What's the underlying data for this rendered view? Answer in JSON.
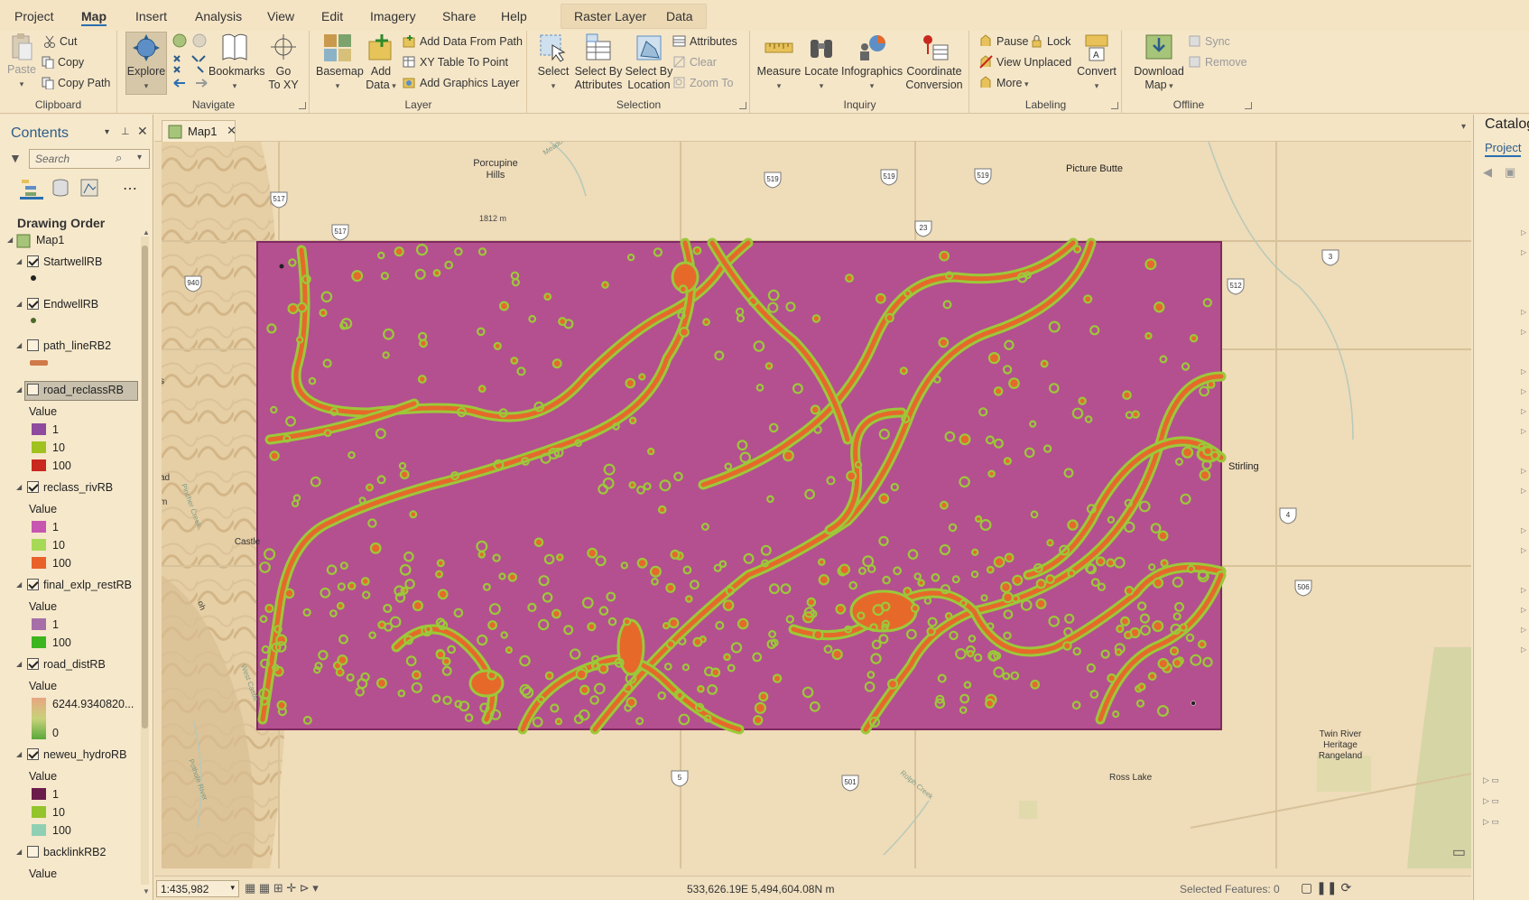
{
  "menubar": {
    "tabs": [
      "Project",
      "Map",
      "Insert",
      "Analysis",
      "View",
      "Edit",
      "Imagery",
      "Share",
      "Help"
    ],
    "active_tab": "Map",
    "context_tabs": [
      "Raster Layer",
      "Data"
    ]
  },
  "ribbon": {
    "clipboard": {
      "label": "Clipboard",
      "paste": "Paste",
      "cut": "Cut",
      "copy": "Copy",
      "copy_path": "Copy Path"
    },
    "navigate": {
      "label": "Navigate",
      "explore": "Explore",
      "bookmarks": "Bookmarks",
      "go_to": "Go",
      "go_to_2": "To XY"
    },
    "layer": {
      "label": "Layer",
      "basemap": "Basemap",
      "add": "Add",
      "add_data": "Data",
      "add_from_path": "Add Data From Path",
      "xy_table": "XY Table To Point",
      "add_graphics": "Add Graphics Layer"
    },
    "selection": {
      "label": "Selection",
      "select": "Select",
      "select_by": "Select By",
      "attributes": "Attributes",
      "location": "Location",
      "attributes_btn": "Attributes",
      "clear": "Clear",
      "zoom_to": "Zoom To"
    },
    "inquiry": {
      "label": "Inquiry",
      "measure": "Measure",
      "locate": "Locate",
      "infographics": "Infographics",
      "coordinate": "Coordinate",
      "conversion": "Conversion"
    },
    "labeling": {
      "label": "Labeling",
      "pause": "Pause",
      "lock": "Lock",
      "view_unplaced": "View Unplaced",
      "more": "More",
      "convert": "Convert"
    },
    "offline": {
      "label": "Offline",
      "download": "Download",
      "map": "Map",
      "sync": "Sync",
      "remove": "Remove"
    }
  },
  "contents": {
    "title": "Contents",
    "search_placeholder": "Search",
    "section": "Drawing Order",
    "map_name": "Map1",
    "value_label": "Value",
    "layers": [
      {
        "name": "StartwellRB",
        "checked": true
      },
      {
        "name": "EndwellRB",
        "checked": true
      },
      {
        "name": "path_lineRB2",
        "checked": false
      },
      {
        "name": "road_reclassRB",
        "checked": false,
        "selected": true,
        "legend": [
          {
            "v": "1",
            "c": "#8e4a9e"
          },
          {
            "v": "10",
            "c": "#9fc21f"
          },
          {
            "v": "100",
            "c": "#c8281e"
          }
        ]
      },
      {
        "name": "reclass_rivRB",
        "checked": true,
        "legend": [
          {
            "v": "1",
            "c": "#c756b0"
          },
          {
            "v": "10",
            "c": "#a6d955"
          },
          {
            "v": "100",
            "c": "#e8622a"
          }
        ]
      },
      {
        "name": "final_exlp_restRB",
        "checked": true,
        "legend": [
          {
            "v": "1",
            "c": "#a66fa8"
          },
          {
            "v": "100",
            "c": "#3db51f"
          }
        ]
      },
      {
        "name": "road_distRB",
        "checked": true,
        "ramp_high": "6244.9340820...",
        "ramp_low": "0"
      },
      {
        "name": "neweu_hydroRB",
        "checked": true,
        "legend": [
          {
            "v": "1",
            "c": "#6a1d4a"
          },
          {
            "v": "10",
            "c": "#93c42b"
          },
          {
            "v": "100",
            "c": "#8fd0b4"
          }
        ]
      },
      {
        "name": "backlinkRB2",
        "checked": false
      }
    ]
  },
  "map": {
    "tab": "Map1",
    "place_labels": [
      "Porcupine Hills",
      "Picture Butte",
      "Stirling",
      "Castle",
      "Twin River Heritage Rangeland",
      "Ross Lake"
    ],
    "twin_river_lines": [
      "Twin River",
      "Heritage",
      "Rangeland"
    ],
    "elevation": "1812 m",
    "road_shields": [
      "517",
      "517",
      "519",
      "519",
      "519",
      "940",
      "23",
      "3",
      "512",
      "4",
      "506",
      "5",
      "501"
    ],
    "water_labels": [
      "Meadow Creek",
      "Pincher Creek",
      "West Castle",
      "Pothole River",
      "Rolph Creek"
    ],
    "edge_labels": [
      "s",
      "ad",
      "m",
      "oh"
    ]
  },
  "status": {
    "scale": "1:435,982",
    "coords": "533,626.19E 5,494,604.08N m",
    "selected": "Selected Features: 0"
  },
  "catalog": {
    "title": "Catalog",
    "tab": "Project"
  },
  "colors": {
    "raster_bg": "#b4508f",
    "buffer_orange": "#e6692a",
    "buffer_green": "#9cc83a",
    "basemap": "#efdcb9",
    "accent": "#2a6fb0"
  }
}
